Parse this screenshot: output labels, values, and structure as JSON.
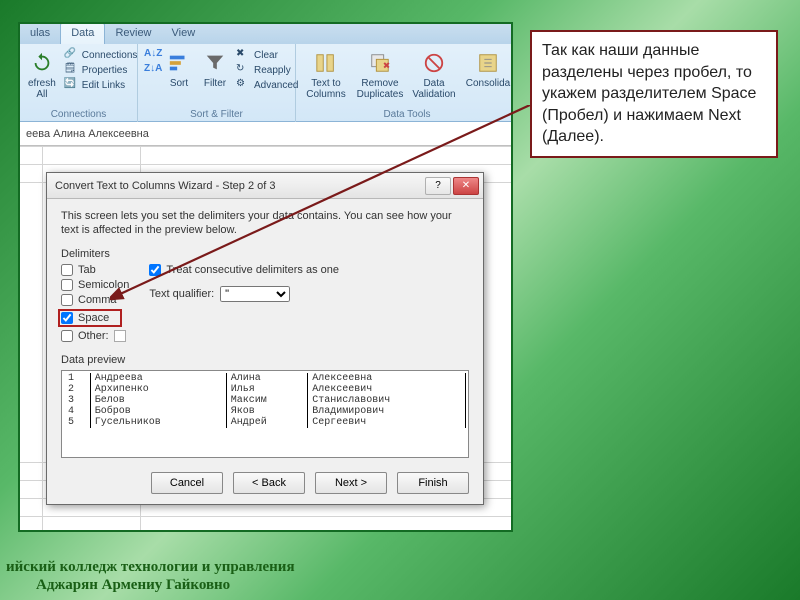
{
  "ribbon": {
    "tabs": [
      "ulas",
      "Data",
      "Review",
      "View"
    ],
    "active_tab": "Data",
    "groups": {
      "connections": {
        "refresh": "efresh\nAll",
        "links": [
          "Connections",
          "Properties",
          "Edit Links"
        ],
        "label": "Connections"
      },
      "sortfilter": {
        "sort_btn": "Sort",
        "filter_btn": "Filter",
        "links": [
          "Clear",
          "Reapply",
          "Advanced"
        ],
        "label": "Sort & Filter"
      },
      "datatools": {
        "text_to_columns": "Text to Columns",
        "remove_dup": "Remove Duplicates",
        "data_val": "Data Validation",
        "consolidate": "Consolida",
        "label": "Data Tools"
      }
    }
  },
  "formula_bar": "еева Алина Алексеевна",
  "dialog": {
    "title": "Convert Text to Columns Wizard - Step 2 of 3",
    "desc": "This screen lets you set the delimiters your data contains.  You can see how your text is affected in the preview below.",
    "delimiters_label": "Delimiters",
    "tab_lbl": "Tab",
    "semicolon_lbl": "Semicolon",
    "comma_lbl": "Comma",
    "space_lbl": "Space",
    "other_lbl": "Other:",
    "treat_lbl": "Treat consecutive delimiters as one",
    "qualifier_lbl": "Text qualifier:",
    "qualifier_val": "\"",
    "preview_label": "Data preview",
    "preview": [
      [
        "1",
        "Андреева",
        "Алина",
        "Алексеевна"
      ],
      [
        "2",
        "Архипенко",
        "Илья",
        "Алексеевич"
      ],
      [
        "3",
        "Белов",
        "Максим",
        "Станиславович"
      ],
      [
        "4",
        "Бобров",
        "Яков",
        "Владимирович"
      ],
      [
        "5",
        "Гусельников",
        "Андрей",
        "Сергеевич"
      ]
    ],
    "buttons": {
      "cancel": "Cancel",
      "back": "< Back",
      "next": "Next >",
      "finish": "Finish"
    }
  },
  "callout": "Так как наши данные разделены через пробел, то укажем разделителем Space (Пробел) и нажимаем Next (Далее).",
  "footer": {
    "line1": "ийский колледж технологии и управления",
    "line2": "Аджарян Армениу Гайковно"
  },
  "colors": {
    "accent_red": "#7a1a1a",
    "green_border": "#136b23"
  }
}
